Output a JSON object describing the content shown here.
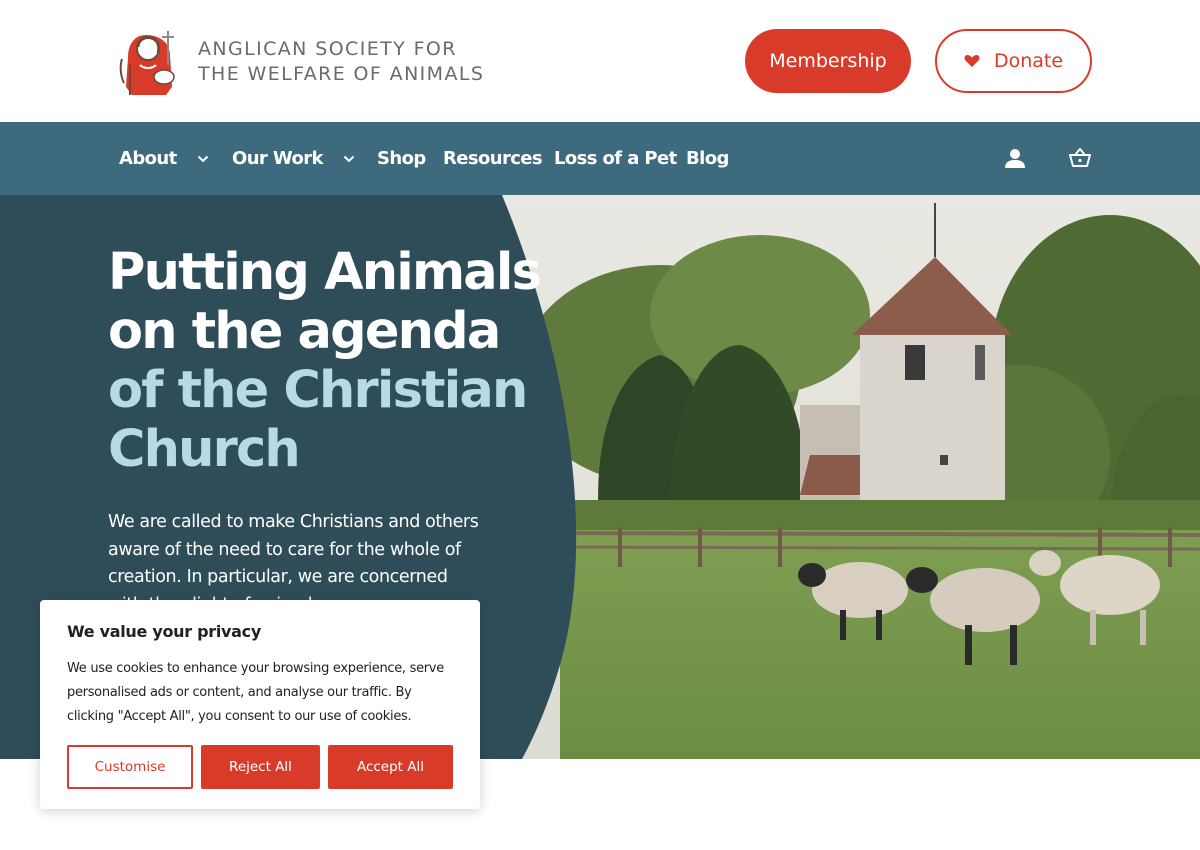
{
  "header": {
    "logo_line1": "ANGLICAN SOCIETY FOR",
    "logo_line2": "THE WELFARE OF ANIMALS",
    "membership_label": "Membership",
    "donate_label": "Donate",
    "logo_icon": "saint-with-lamb-logo",
    "donate_icon": "heart-icon"
  },
  "nav": {
    "items": [
      {
        "label": "About",
        "has_dropdown": true
      },
      {
        "label": "Our Work",
        "has_dropdown": true
      },
      {
        "label": "Shop",
        "has_dropdown": false
      },
      {
        "label": "Resources",
        "has_dropdown": false
      },
      {
        "label": "Loss of a Pet",
        "has_dropdown": false
      },
      {
        "label": "Blog",
        "has_dropdown": false
      }
    ],
    "icons": [
      "user-icon",
      "basket-icon"
    ]
  },
  "hero": {
    "title_line1": "Putting Animals",
    "title_line2": "on the agenda",
    "title_line3": "of the Christian",
    "title_line4": "Church",
    "body": "We are called to make Christians and others aware of the need to care for the whole of creation. In particular, we are concerned with the plight of animals.",
    "image": "church-with-sheep-in-field"
  },
  "cookie": {
    "title": "We value your privacy",
    "text": "We use cookies to enhance your browsing experience, serve personalised ads or content, and analyse our traffic. By clicking \"Accept All\", you consent to our use of cookies.",
    "customise_label": "Customise",
    "reject_label": "Reject All",
    "accept_label": "Accept All"
  },
  "colors": {
    "brand_red": "#d83b2a",
    "nav_teal": "#3e6a7e",
    "hero_dark": "#2f4d59",
    "hero_accent": "#b7dbe6",
    "logo_gray": "#6b6b6b"
  }
}
